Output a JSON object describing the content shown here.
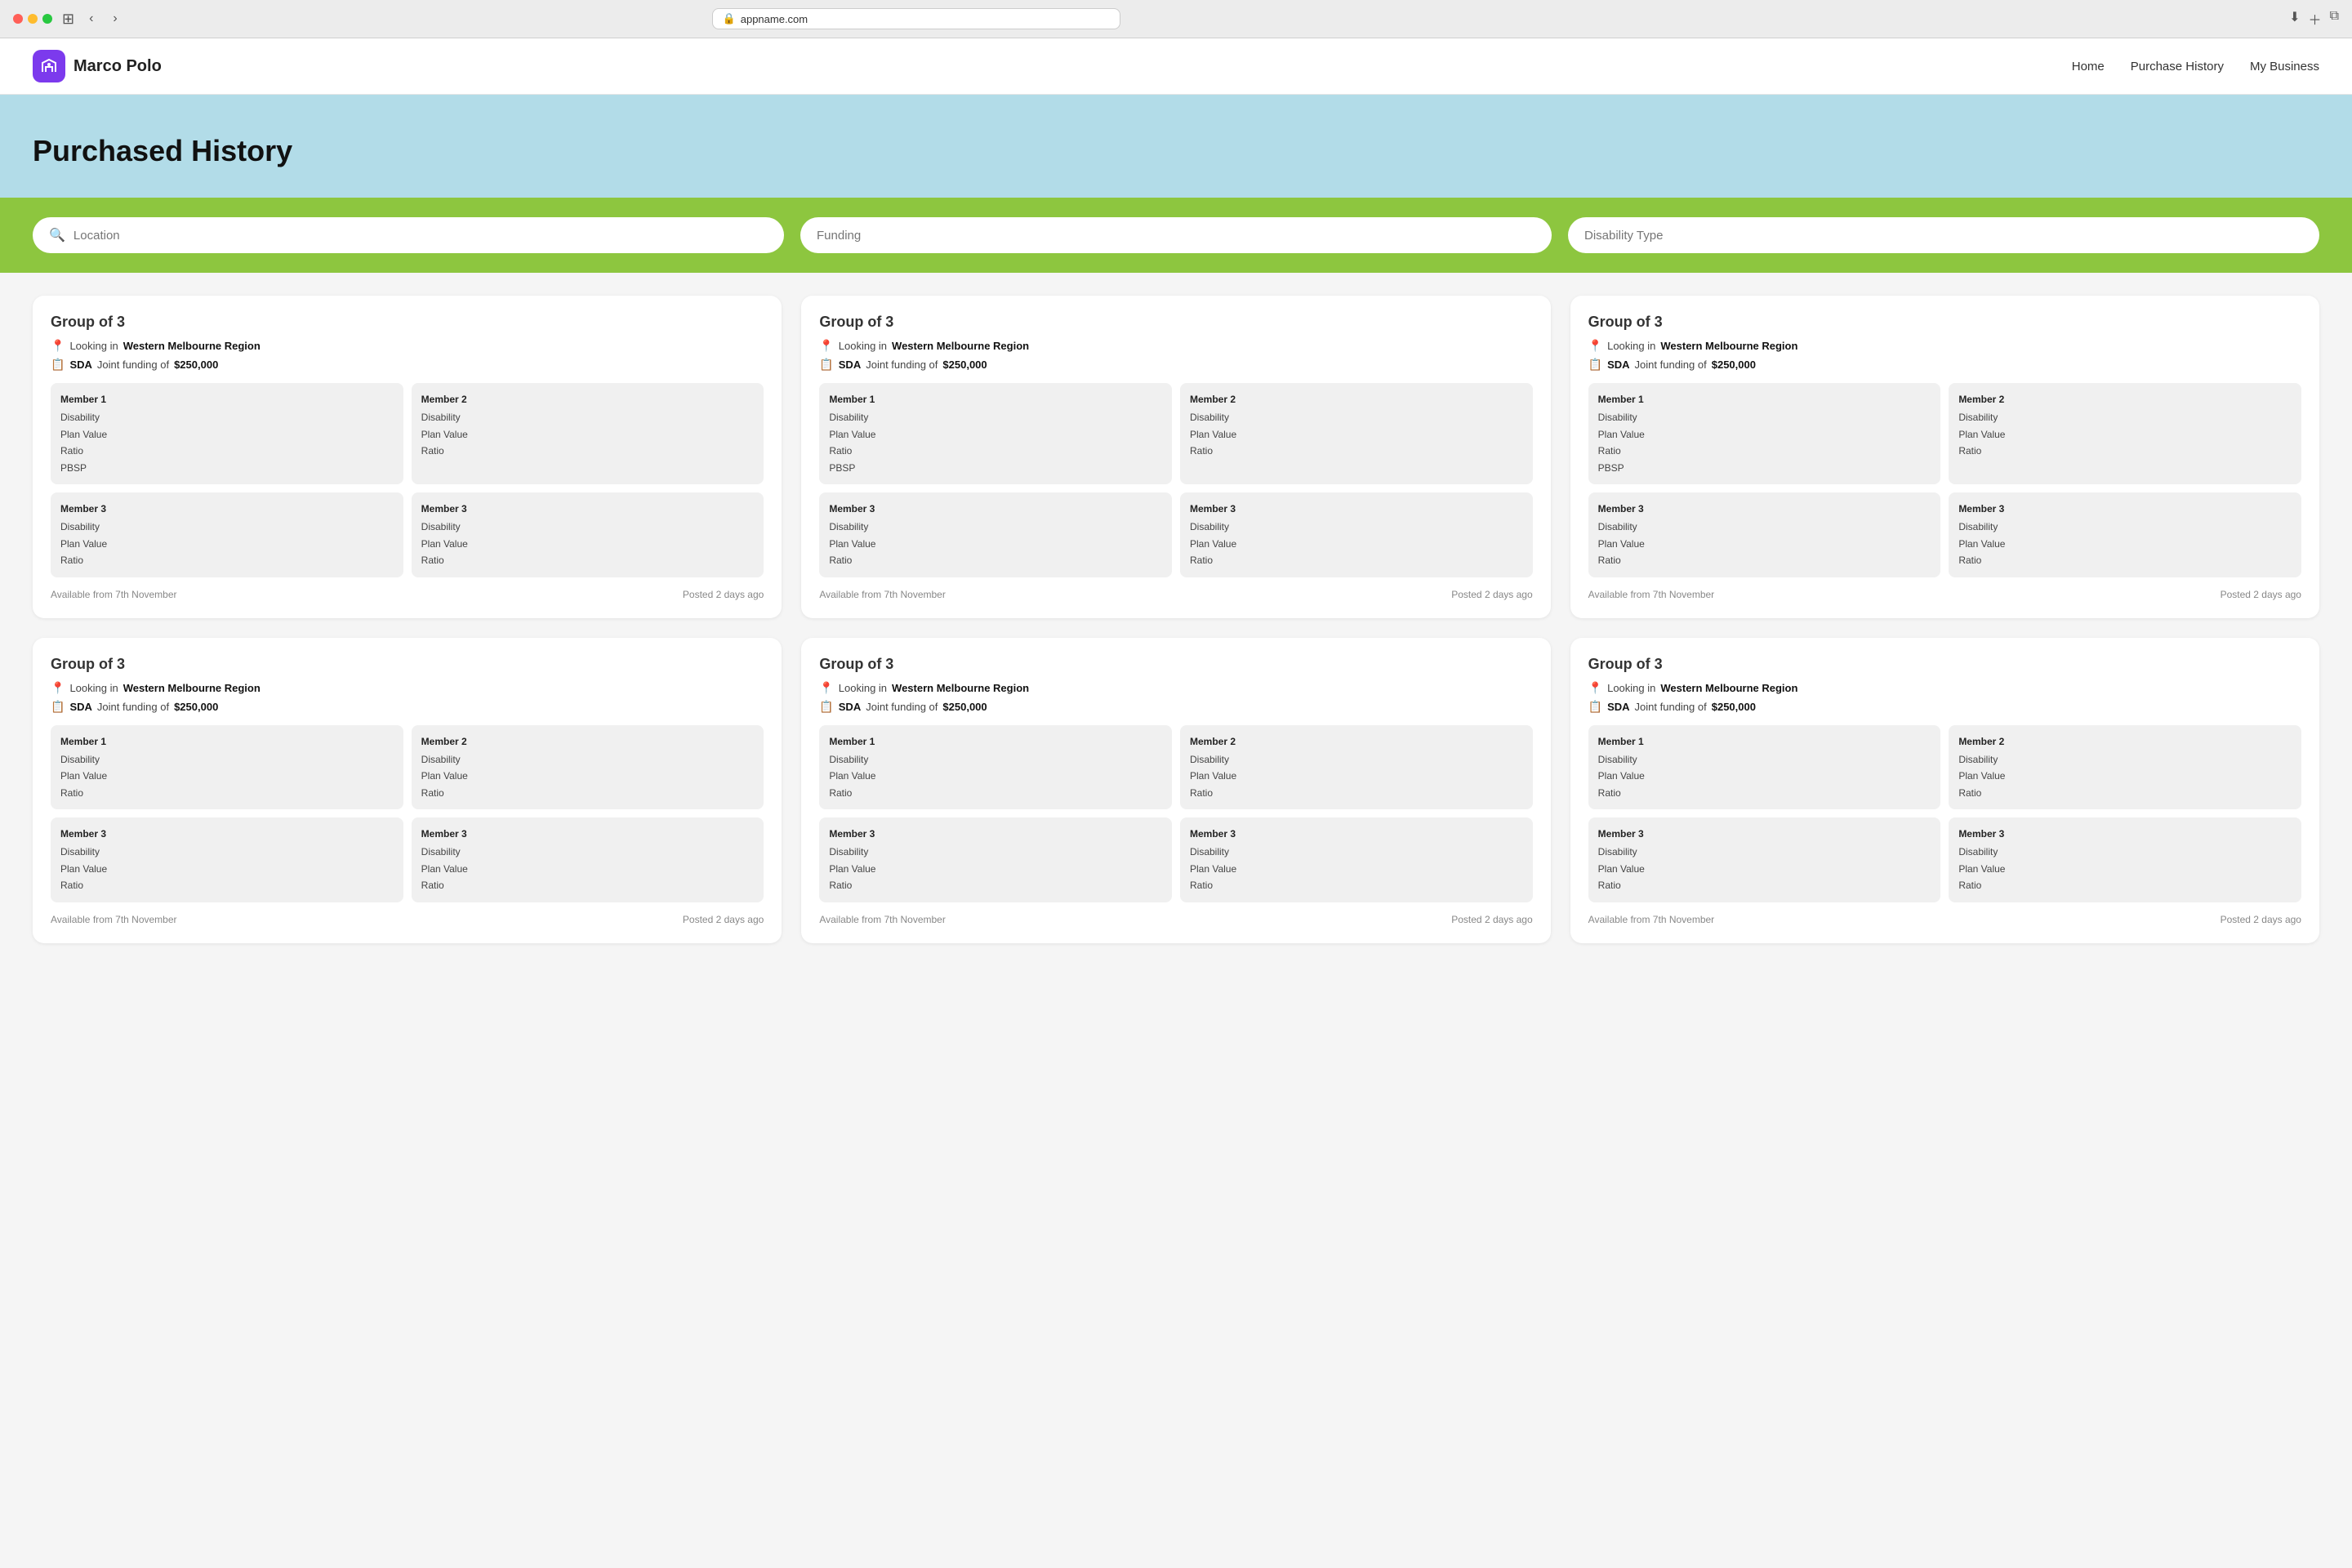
{
  "browser": {
    "url": "appname.com",
    "back_label": "←",
    "forward_label": "→"
  },
  "header": {
    "logo_text": "Marco Polo",
    "nav": [
      {
        "label": "Home",
        "href": "#"
      },
      {
        "label": "Purchase History",
        "href": "#"
      },
      {
        "label": "My Business",
        "href": "#"
      }
    ]
  },
  "hero": {
    "title": "Purchased History"
  },
  "search": {
    "location_placeholder": "Location",
    "funding_placeholder": "Funding",
    "disability_placeholder": "Disability Type"
  },
  "cards": [
    {
      "title": "Group of 3",
      "location": "Western Melbourne Region",
      "funding_type": "SDA",
      "funding_label": "Joint funding of",
      "funding_amount": "$250,000",
      "members": [
        {
          "label": "Member 1",
          "lines": [
            "Disability",
            "Plan Value",
            "Ratio",
            "PBSP"
          ]
        },
        {
          "label": "Member 2",
          "lines": [
            "Disability",
            "Plan Value",
            "Ratio"
          ]
        },
        {
          "label": "Member 3",
          "lines": [
            "Disability",
            "Plan Value",
            "Ratio"
          ]
        },
        {
          "label": "Member 3",
          "lines": [
            "Disability",
            "Plan Value",
            "Ratio"
          ]
        }
      ],
      "available": "Available from 7th November",
      "posted": "Posted 2 days ago"
    },
    {
      "title": "Group of 3",
      "location": "Western Melbourne Region",
      "funding_type": "SDA",
      "funding_label": "Joint funding of",
      "funding_amount": "$250,000",
      "members": [
        {
          "label": "Member 1",
          "lines": [
            "Disability",
            "Plan Value",
            "Ratio",
            "PBSP"
          ]
        },
        {
          "label": "Member 2",
          "lines": [
            "Disability",
            "Plan Value",
            "Ratio"
          ]
        },
        {
          "label": "Member 3",
          "lines": [
            "Disability",
            "Plan Value",
            "Ratio"
          ]
        },
        {
          "label": "Member 3",
          "lines": [
            "Disability",
            "Plan Value",
            "Ratio"
          ]
        }
      ],
      "available": "Available from 7th November",
      "posted": "Posted 2 days ago"
    },
    {
      "title": "Group of 3",
      "location": "Western Melbourne Region",
      "funding_type": "SDA",
      "funding_label": "Joint funding of",
      "funding_amount": "$250,000",
      "members": [
        {
          "label": "Member 1",
          "lines": [
            "Disability",
            "Plan Value",
            "Ratio",
            "PBSP"
          ]
        },
        {
          "label": "Member 2",
          "lines": [
            "Disability",
            "Plan Value",
            "Ratio"
          ]
        },
        {
          "label": "Member 3",
          "lines": [
            "Disability",
            "Plan Value",
            "Ratio"
          ]
        },
        {
          "label": "Member 3",
          "lines": [
            "Disability",
            "Plan Value",
            "Ratio"
          ]
        }
      ],
      "available": "Available from 7th November",
      "posted": "Posted 2 days ago"
    },
    {
      "title": "Group of 3",
      "location": "Western Melbourne Region",
      "funding_type": "SDA",
      "funding_label": "Joint funding of",
      "funding_amount": "$250,000",
      "members": [
        {
          "label": "Member 1",
          "lines": [
            "Disability",
            "Plan Value",
            "Ratio"
          ]
        },
        {
          "label": "Member 2",
          "lines": [
            "Disability",
            "Plan Value",
            "Ratio"
          ]
        },
        {
          "label": "Member 3",
          "lines": [
            "Disability",
            "Plan Value",
            "Ratio"
          ]
        },
        {
          "label": "Member 3",
          "lines": [
            "Disability",
            "Plan Value",
            "Ratio"
          ]
        }
      ],
      "available": "Available from 7th November",
      "posted": "Posted 2 days ago"
    },
    {
      "title": "Group of 3",
      "location": "Western Melbourne Region",
      "funding_type": "SDA",
      "funding_label": "Joint funding of",
      "funding_amount": "$250,000",
      "members": [
        {
          "label": "Member 1",
          "lines": [
            "Disability",
            "Plan Value",
            "Ratio"
          ]
        },
        {
          "label": "Member 2",
          "lines": [
            "Disability",
            "Plan Value",
            "Ratio"
          ]
        },
        {
          "label": "Member 3",
          "lines": [
            "Disability",
            "Plan Value",
            "Ratio"
          ]
        },
        {
          "label": "Member 3",
          "lines": [
            "Disability",
            "Plan Value",
            "Ratio"
          ]
        }
      ],
      "available": "Available from 7th November",
      "posted": "Posted 2 days ago"
    },
    {
      "title": "Group of 3",
      "location": "Western Melbourne Region",
      "funding_type": "SDA",
      "funding_label": "Joint funding of",
      "funding_amount": "$250,000",
      "members": [
        {
          "label": "Member 1",
          "lines": [
            "Disability",
            "Plan Value",
            "Ratio"
          ]
        },
        {
          "label": "Member 2",
          "lines": [
            "Disability",
            "Plan Value",
            "Ratio"
          ]
        },
        {
          "label": "Member 3",
          "lines": [
            "Disability",
            "Plan Value",
            "Ratio"
          ]
        },
        {
          "label": "Member 3",
          "lines": [
            "Disability",
            "Plan Value",
            "Ratio"
          ]
        }
      ],
      "available": "Available from 7th November",
      "posted": "Posted 2 days ago"
    }
  ]
}
